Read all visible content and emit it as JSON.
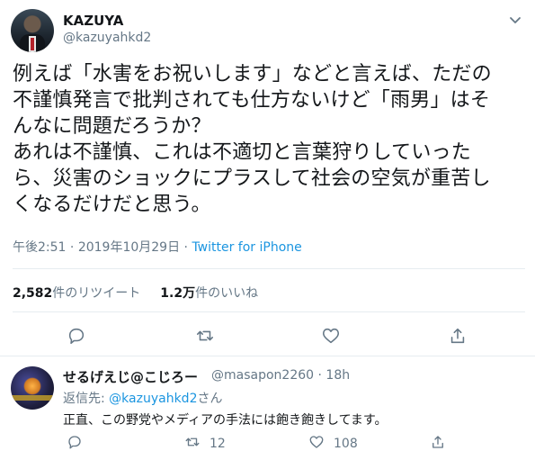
{
  "tweet": {
    "author_name": "KAZUYA",
    "author_handle": "@kazuyahkd2",
    "text": "例えば「水害をお祝いします」などと言えば、ただの\n不謹慎発言で批判されても仕方ないけど「雨男」はそ\nんなに問題だろうか？\nあれは不謹慎、これは不適切と言葉狩りしていった\nら、災害のショックにプラスして社会の空気が重苦し\nくなるだけだと思う。",
    "time": "午後2:51",
    "date": "2019年10月29日",
    "separator": "·",
    "source": "Twitter for iPhone",
    "retweet_count": "2,582",
    "retweet_label": "件のリツイート",
    "like_count": "1.2万",
    "like_label": "件のいいね"
  },
  "reply": {
    "author_name": "せるげえじ@こじろー",
    "author_handle": "@masapon2260",
    "time": "18h",
    "reply_to_prefix": "返信先:",
    "reply_to_handle": "@kazuyahkd2",
    "reply_to_suffix": "さん",
    "text": "正直、この野党やメディアの手法には飽き飽きしてます。",
    "retweet_count": "12",
    "like_count": "108"
  },
  "icons": {
    "caret": "chevron-down-icon",
    "reply": "reply-icon",
    "retweet": "retweet-icon",
    "like": "heart-icon",
    "share": "share-icon"
  },
  "colors": {
    "link": "#1b95e0",
    "muted": "#657786",
    "text": "#14171a",
    "divider": "#e6ecf0"
  }
}
